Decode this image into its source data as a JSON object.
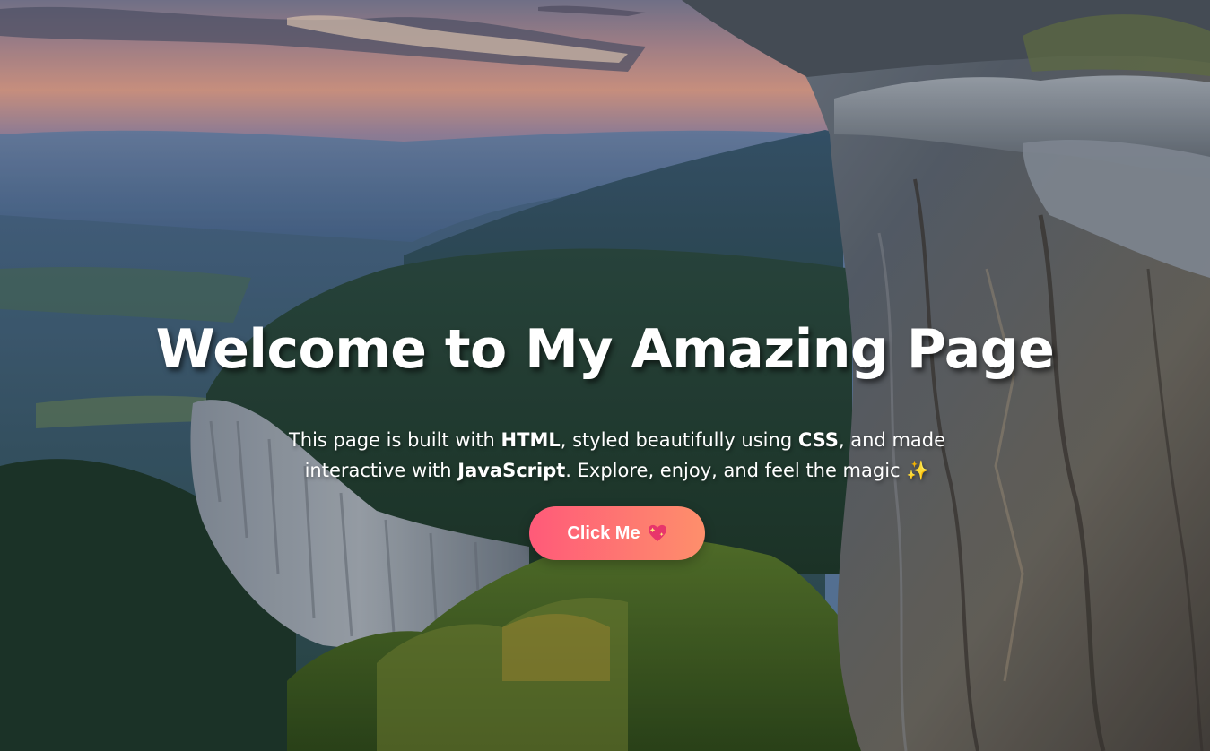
{
  "hero": {
    "title": "Welcome to My Amazing Page",
    "tagline": {
      "part1": "This page is built with ",
      "html": "HTML",
      "part2": ", styled beautifully using ",
      "css": "CSS",
      "part3": ", and made interactive with ",
      "js": "JavaScript",
      "part4": ". Explore, enjoy, and feel the magic ",
      "sparkle": "✨"
    },
    "button": {
      "label": "Click Me",
      "icon": "sparkling-heart-icon"
    },
    "background": "mountain-cliff-sunset-photo"
  },
  "colors": {
    "button_gradient_start": "#ff5a79",
    "button_gradient_end": "#fe8f6b",
    "text": "#ffffff"
  }
}
